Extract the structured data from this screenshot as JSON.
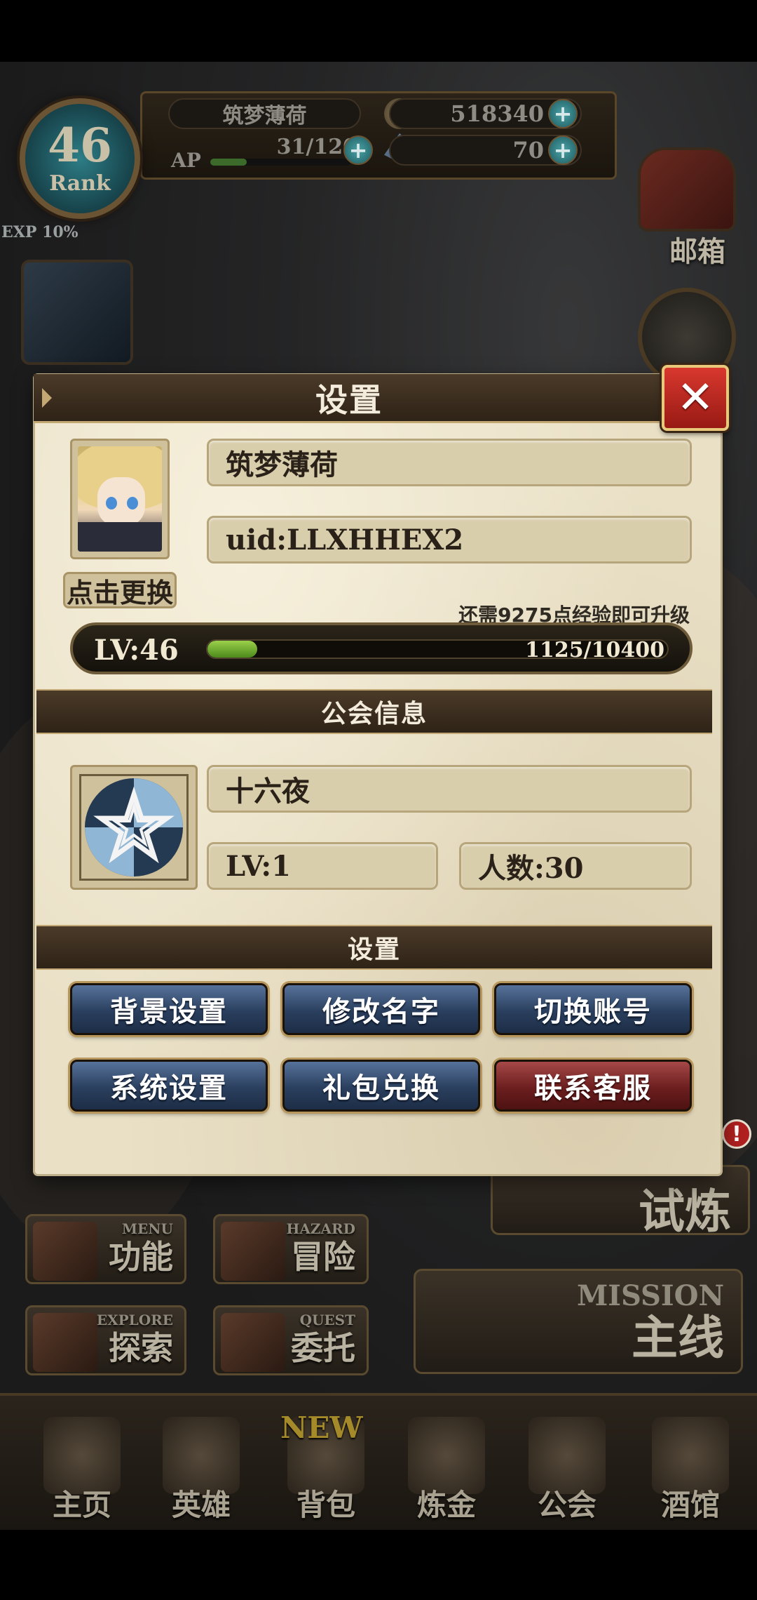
{
  "hud": {
    "player_name": "筑梦薄荷",
    "gold": "518340",
    "ap_label": "AP",
    "ap": "31/120",
    "ap_fraction": 0.26,
    "gems": "70",
    "rank_value": "46",
    "rank_label": "Rank",
    "exp_text": "EXP 10%",
    "plus_symbol": "+"
  },
  "side": {
    "mailbox": "邮箱"
  },
  "modal": {
    "title": "设置",
    "close_symbol": "✕",
    "profile": {
      "name": "筑梦薄荷",
      "uid": "uid:LLXHHEX2",
      "change_avatar": "点击更换",
      "exp_hint": "还需9275点经验即可升级",
      "level": "LV:46",
      "exp_value": "1125/10400",
      "exp_fraction": 0.108
    },
    "guild_section_title": "公会信息",
    "guild": {
      "name": "十六夜",
      "level": "LV:1",
      "members": "人数:30"
    },
    "settings_section_title": "设置",
    "buttons": [
      {
        "label": "背景设置",
        "color": "blue"
      },
      {
        "label": "修改名字",
        "color": "blue"
      },
      {
        "label": "切换账号",
        "color": "blue"
      },
      {
        "label": "系统设置",
        "color": "blue"
      },
      {
        "label": "礼包兑换",
        "color": "blue"
      },
      {
        "label": "联系客服",
        "color": "red"
      }
    ]
  },
  "menu": {
    "function": {
      "en": "MENU",
      "zh": "功能"
    },
    "adventure": {
      "en": "HAZARD",
      "zh": "冒险"
    },
    "explore": {
      "en": "EXPLORE",
      "zh": "探索"
    },
    "quest": {
      "en": "QUEST",
      "zh": "委托"
    },
    "trial": {
      "zh": "试炼"
    },
    "mission": {
      "en": "MISSION",
      "zh": "主线"
    },
    "alert_symbol": "!"
  },
  "bottom_nav": {
    "new_badge": "NEW",
    "items": [
      "主页",
      "英雄",
      "背包",
      "炼金",
      "公会",
      "酒馆"
    ]
  },
  "colors": {
    "panel": "#e9e0c6",
    "button_blue": "#2a3f5e",
    "button_red": "#6c1e1e",
    "close_red": "#d8382e",
    "exp_green": "#9bd04a"
  }
}
